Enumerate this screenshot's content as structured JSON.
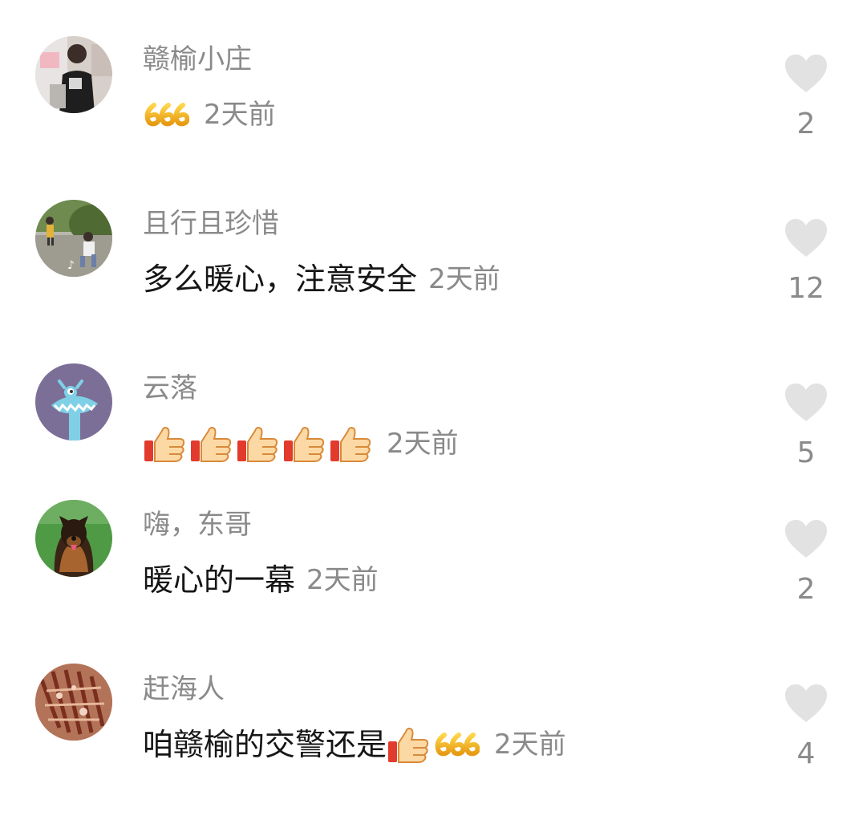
{
  "comments": [
    {
      "username": "赣榆小庄",
      "text": "",
      "emojis": [
        "666-emoji"
      ],
      "time": "2天前",
      "likes": "2",
      "avatar": "avatar-man-photo"
    },
    {
      "username": "且行且珍惜",
      "text": "多么暖心，注意安全",
      "emojis": [],
      "time": "2天前",
      "likes": "12",
      "avatar": "avatar-children-photo"
    },
    {
      "username": "云落",
      "text": "",
      "emojis": [
        "thumbs-up-emoji",
        "thumbs-up-emoji",
        "thumbs-up-emoji",
        "thumbs-up-emoji",
        "thumbs-up-emoji"
      ],
      "time": "2天前",
      "likes": "5",
      "avatar": "avatar-cartoon-monster"
    },
    {
      "username": "嗨，东哥",
      "text": "暖心的一幕",
      "emojis": [],
      "time": "2天前",
      "likes": "2",
      "avatar": "avatar-dog-photo"
    },
    {
      "username": "赶海人",
      "text": "咱赣榆的交警还是",
      "emojis": [
        "thumbs-up-emoji",
        "666-emoji"
      ],
      "time": "2天前",
      "likes": "4",
      "avatar": "avatar-seafood-photo"
    }
  ],
  "colors": {
    "secondary_text": "#8a8a8a",
    "primary_text": "#161616",
    "heart": "#e2e2e2",
    "avatar_purple": "#7c6f97"
  }
}
